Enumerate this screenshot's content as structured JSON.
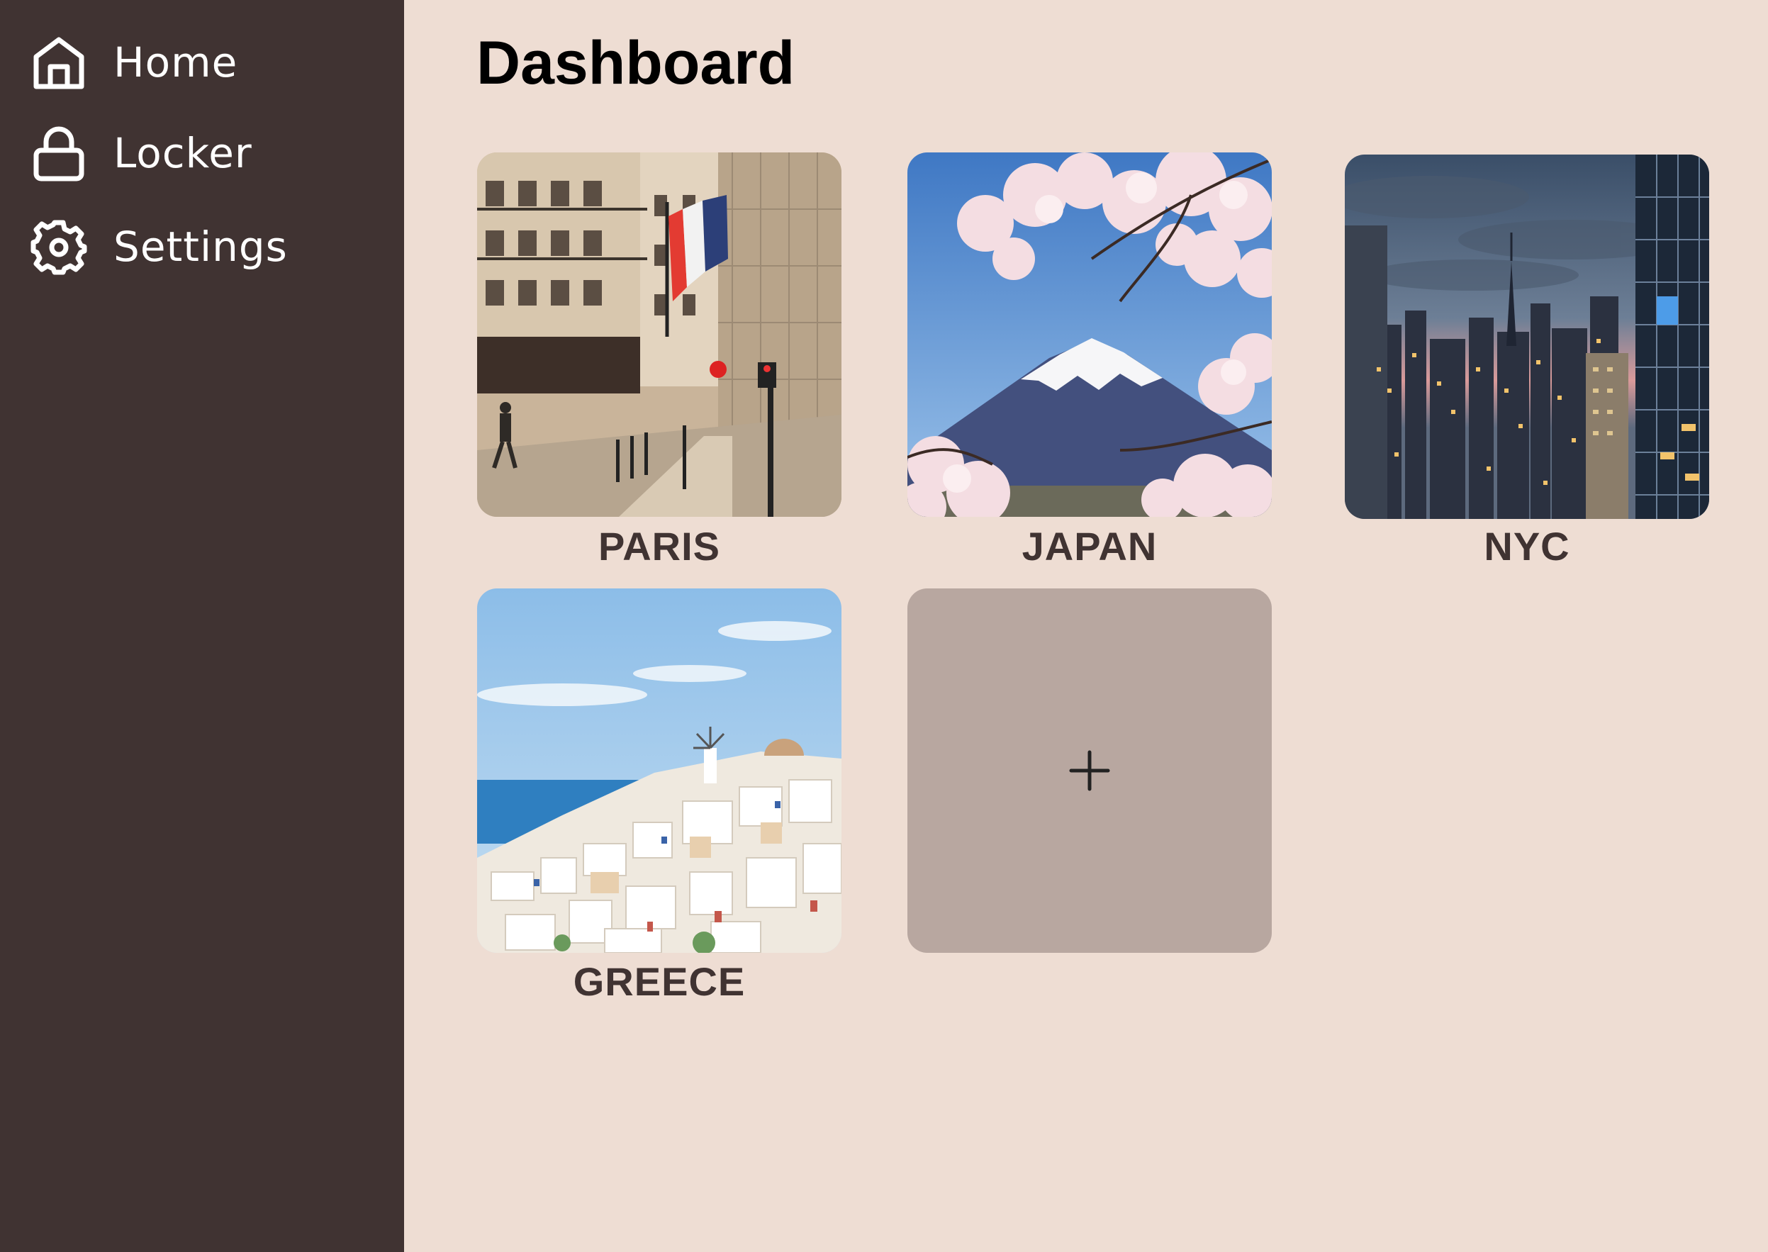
{
  "sidebar": {
    "items": [
      {
        "label": "Home",
        "icon": "home-icon"
      },
      {
        "label": "Locker",
        "icon": "lock-icon"
      },
      {
        "label": "Settings",
        "icon": "gear-icon"
      }
    ]
  },
  "main": {
    "title": "Dashboard",
    "destinations": [
      {
        "label": "PARIS"
      },
      {
        "label": "JAPAN"
      },
      {
        "label": "NYC"
      },
      {
        "label": "GREECE"
      }
    ],
    "add_icon": "plus-icon"
  },
  "colors": {
    "sidebar_bg": "#403332",
    "page_bg": "#eeddd3",
    "add_card_bg": "#b8a7a0",
    "caption_text": "#403332"
  }
}
